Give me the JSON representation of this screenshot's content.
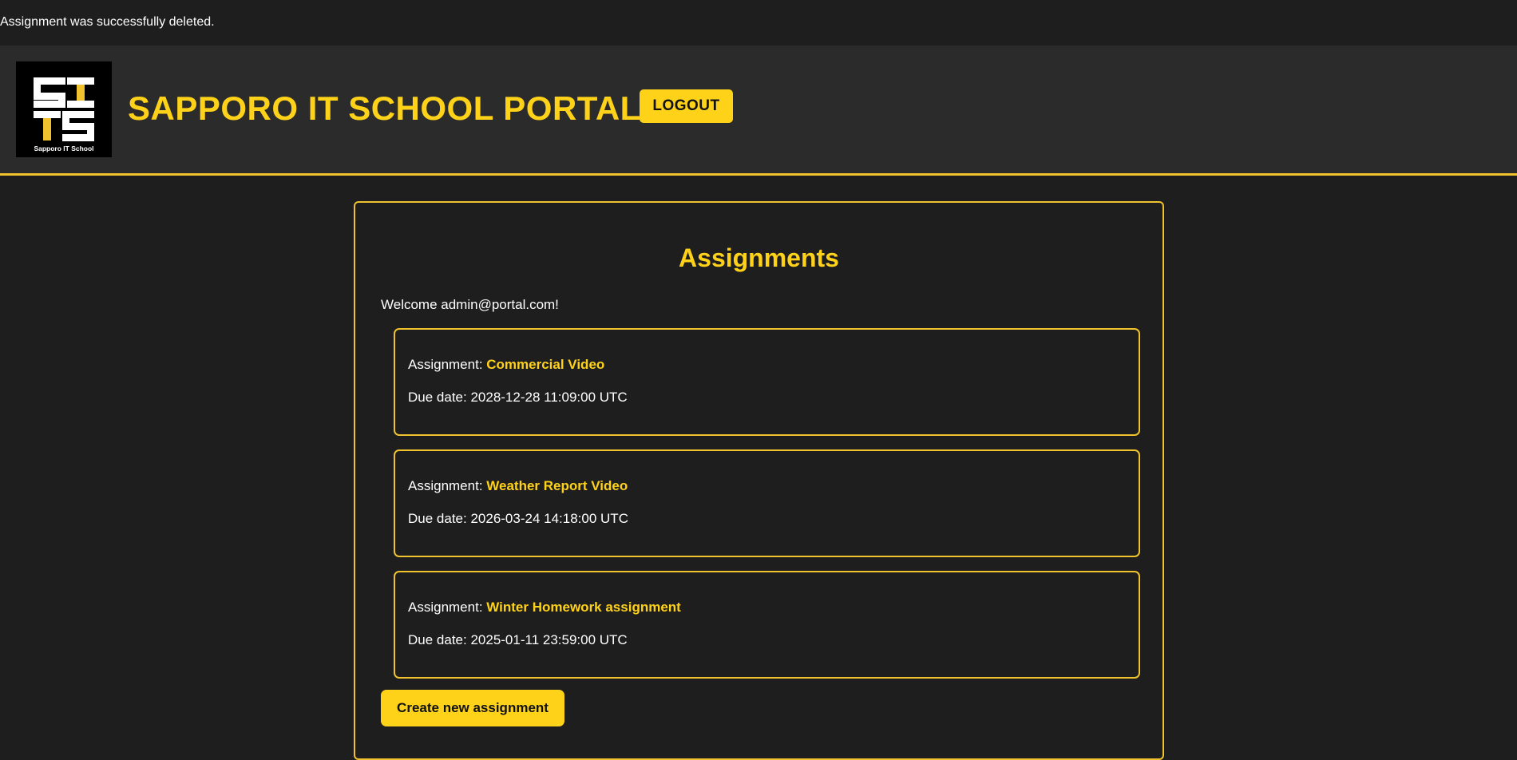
{
  "flash": {
    "message": "Assignment was successfully deleted."
  },
  "header": {
    "logo_alt": "SITS Sapporo IT School",
    "logo_subtitle": "Sapporo IT School",
    "title": "SAPPORO IT SCHOOL PORTAL",
    "logout_label": "LOGOUT"
  },
  "main": {
    "title": "Assignments",
    "welcome": "Welcome admin@portal.com!",
    "assignment_prefix": "Assignment: ",
    "due_prefix": "Due date: ",
    "assignments": [
      {
        "name": "Commercial Video",
        "due": "2028-12-28 11:09:00 UTC"
      },
      {
        "name": "Weather Report Video",
        "due": "2026-03-24 14:18:00 UTC"
      },
      {
        "name": "Winter Homework assignment",
        "due": "2025-01-11 23:59:00 UTC"
      }
    ],
    "create_label": "Create new assignment"
  },
  "colors": {
    "background": "#1e1e1e",
    "header_bg": "#2b2b2b",
    "accent": "#ffd21a",
    "border": "#f0c22d",
    "text": "#ffffff"
  }
}
